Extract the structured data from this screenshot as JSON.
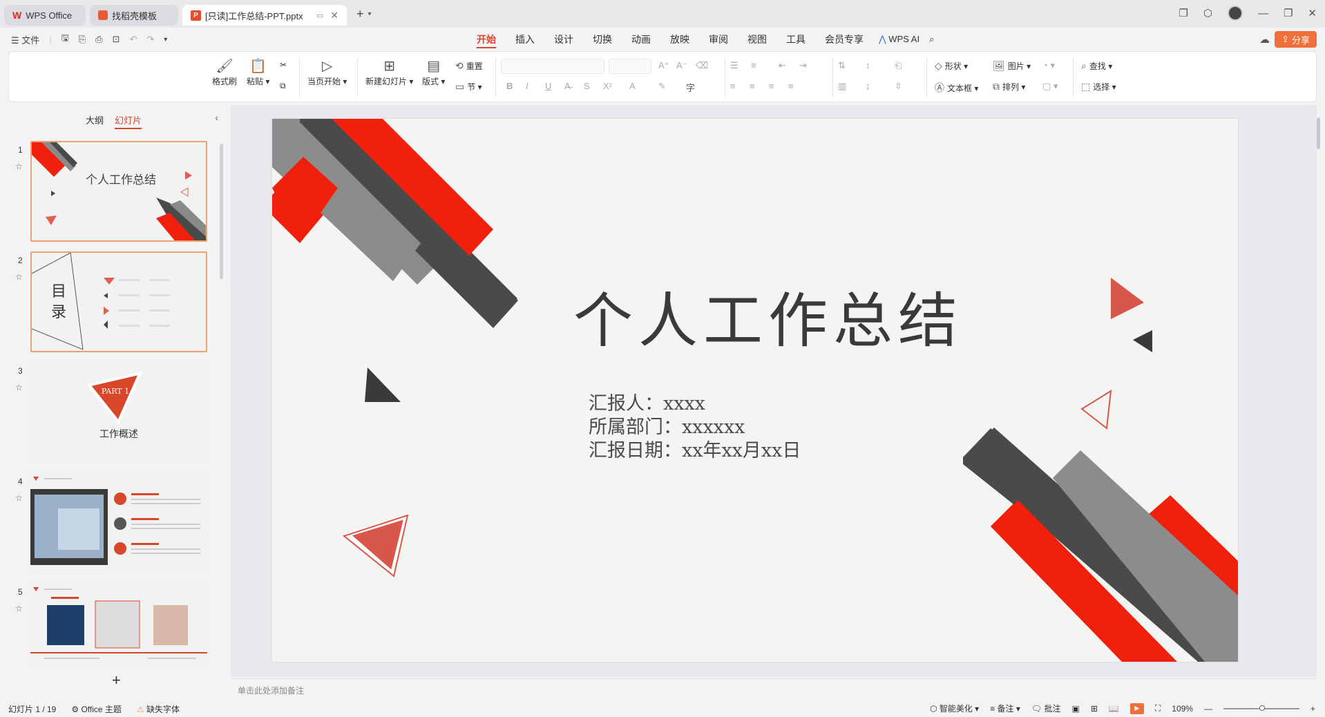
{
  "titlebar": {
    "tabs": [
      {
        "label": "WPS Office"
      },
      {
        "label": "找稻壳模板"
      },
      {
        "label": "[只读]工作总结-PPT.pptx"
      }
    ],
    "new_tab": "+"
  },
  "menu": {
    "file": "文件",
    "ribbon_tabs": [
      "开始",
      "插入",
      "设计",
      "切换",
      "动画",
      "放映",
      "审阅",
      "视图",
      "工具",
      "会员专享"
    ],
    "wps_ai": "WPS AI",
    "share": "分享"
  },
  "ribbon": {
    "format_painter": "格式刷",
    "paste": "粘贴",
    "play_from_current": "当页开始",
    "new_slide": "新建幻灯片",
    "layout": "版式",
    "reset": "重置",
    "section": "节",
    "shape": "形状",
    "picture": "图片",
    "textbox": "文本框",
    "arrange": "排列",
    "find": "查找",
    "select": "选择"
  },
  "left_panel": {
    "tab_outline": "大纲",
    "tab_slides": "幻灯片",
    "thumbnails": [
      {
        "num": "1",
        "title": "个人工作总结"
      },
      {
        "num": "2",
        "title": "目录"
      },
      {
        "num": "3",
        "part": "PART 1",
        "title": "工作概述"
      },
      {
        "num": "4"
      },
      {
        "num": "5"
      }
    ]
  },
  "slide": {
    "title": "个人工作总结",
    "reporter": "汇报人：xxxx",
    "department": "所属部门：xxxxxx",
    "date": "汇报日期：xx年xx月xx日"
  },
  "notes_placeholder": "单击此处添加备注",
  "status": {
    "slide_count": "幻灯片 1 / 19",
    "theme": "Office 主题",
    "missing_font": "缺失字体",
    "beautify": "智能美化",
    "notes": "备注",
    "comments": "批注",
    "zoom": "109%"
  },
  "colors": {
    "accent": "#d9472b",
    "red": "#f0200c",
    "dark_gray": "#4a4a4a",
    "mid_gray": "#8a8a8a"
  }
}
